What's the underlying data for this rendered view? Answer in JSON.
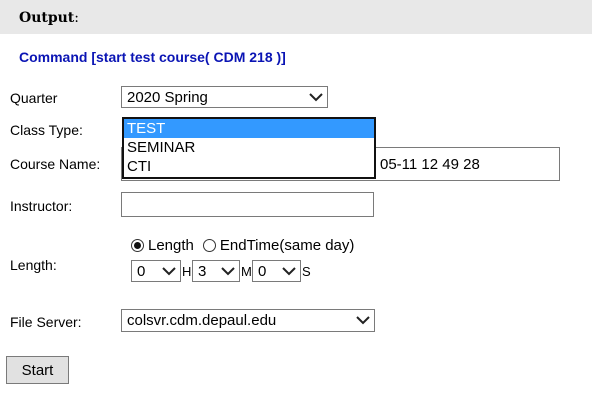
{
  "header": {
    "title": "Output",
    "colon": ":"
  },
  "command": "Command [start test course( CDM 218 )]",
  "form": {
    "quarter": {
      "label": "Quarter",
      "value": "2020 Spring"
    },
    "class_type": {
      "label": "Class Type:",
      "options": [
        "TEST",
        "SEMINAR",
        "CTI"
      ],
      "selected": "TEST"
    },
    "course_name": {
      "label": "Course Name:",
      "value_visible": "05-11 12 49 28"
    },
    "instructor": {
      "label": "Instructor:",
      "value": ""
    },
    "length": {
      "label": "Length:",
      "radio_length": "Length",
      "radio_endtime": "EndTime(same day)",
      "hours": "0",
      "hours_unit": "H",
      "minutes": "3",
      "minutes_unit": "M",
      "seconds": "0",
      "seconds_unit": "S"
    },
    "file_server": {
      "label": "File Server:",
      "value": "colsvr.cdm.depaul.edu"
    }
  },
  "start_button": "Start"
}
